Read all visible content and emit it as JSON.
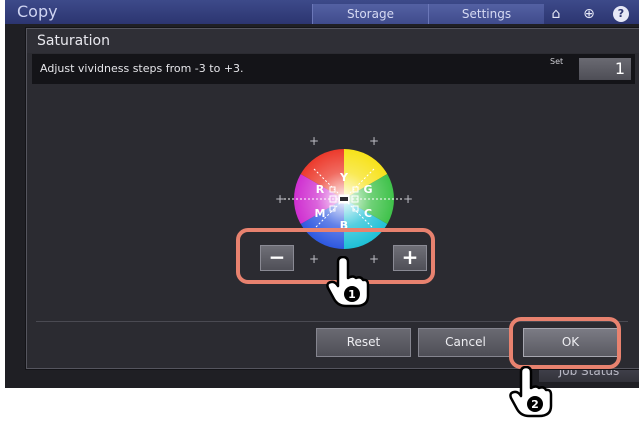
{
  "topbar": {
    "app_title": "Copy",
    "tabs": [
      "Storage",
      "Settings"
    ],
    "icons": [
      "home-icon",
      "globe-icon",
      "help-icon"
    ]
  },
  "job_status": "Job Status",
  "dialog": {
    "title": "Saturation",
    "description": "Adjust vividness steps from -3 to +3.",
    "set_label": "Set",
    "set_value": "1",
    "wheel_letters": [
      "R",
      "Y",
      "G",
      "M",
      "B",
      "C"
    ],
    "minus_label": "−",
    "plus_label": "+",
    "buttons": {
      "reset": "Reset",
      "cancel": "Cancel",
      "ok": "OK"
    }
  },
  "callouts": {
    "step1": "1",
    "step2": "2"
  },
  "colors": {
    "highlight": "#e8826f",
    "topbar": "#2c3570"
  }
}
